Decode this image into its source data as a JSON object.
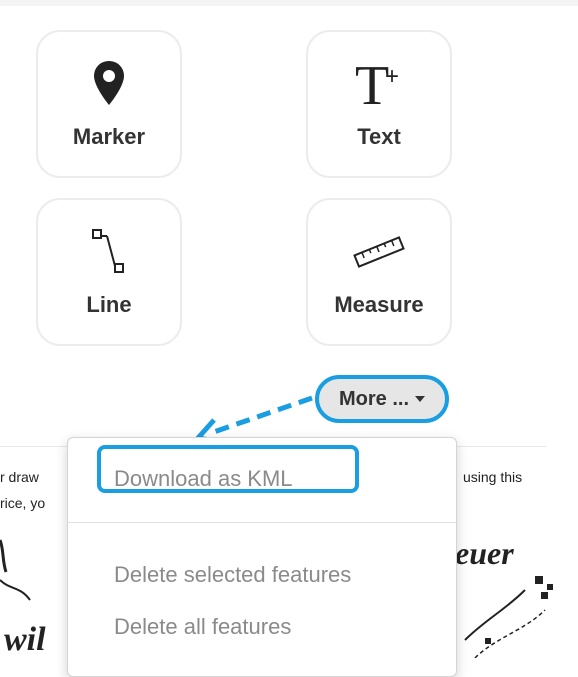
{
  "tools": [
    {
      "label": "Marker",
      "icon": "map-pin-icon"
    },
    {
      "label": "Text",
      "icon": "text-add-icon"
    },
    {
      "label": "Line",
      "icon": "polyline-icon"
    },
    {
      "label": "Measure",
      "icon": "ruler-icon"
    }
  ],
  "more": {
    "label": "More ..."
  },
  "background_text": {
    "left_line1": "r draw",
    "left_line2": "rice, yo",
    "right_line1": "using this",
    "map_label_top": "euer",
    "map_label_bottom": "wil"
  },
  "dropdown": {
    "items": [
      "Download as KML",
      "Delete selected features",
      "Delete all features"
    ]
  },
  "colors": {
    "accent": "#1a9ee2",
    "label": "#333333",
    "menu_text": "#8a8a8a"
  }
}
